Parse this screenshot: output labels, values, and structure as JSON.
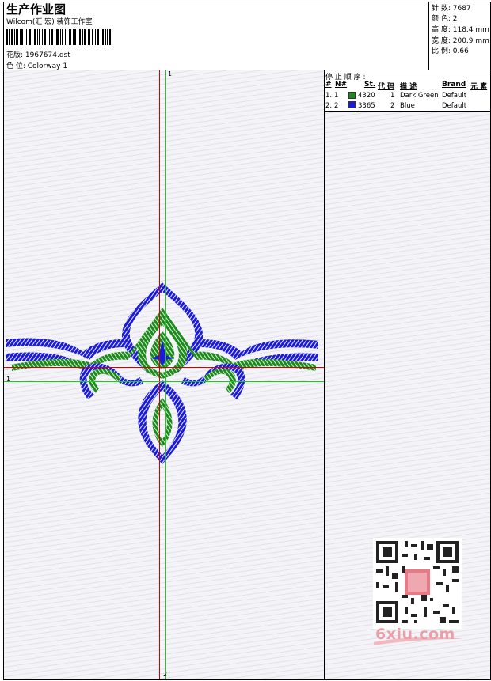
{
  "header": {
    "title": "生产作业图",
    "company": "Wilcom(汇 宏) 装饰工作室",
    "design": "花版: 1967674.dst",
    "colorway": "色 位:  Colorway 1"
  },
  "stats": {
    "stitches": "针 数:  7687",
    "colors": "颜 色:  2",
    "height": "高 度:  118.4 mm",
    "width": "宽 度:  200.9 mm",
    "scale": "比 例:  0.66"
  },
  "stop_sequence": {
    "label": "停 止 顺 序 :",
    "headers": [
      "#",
      "N#",
      "St.",
      "代 码",
      "描 述",
      "Brand",
      "元 素"
    ],
    "rows": [
      {
        "index": "1.",
        "n": "1",
        "stitches": "4320",
        "code": "1",
        "desc": "Dark Green",
        "brand": "Default",
        "color": "#1e8a1e"
      },
      {
        "index": "2.",
        "n": "2",
        "stitches": "3365",
        "code": "2",
        "desc": "Blue",
        "brand": "Default",
        "color": "#1a1ad8"
      }
    ]
  },
  "axes": {
    "top_label": "1",
    "left_label": "1",
    "bottom_label": "2"
  },
  "colors": {
    "green": "#1e8a1e",
    "blue": "#1a1ad8",
    "axis_red": "#d40000",
    "axis_green": "#1ec81e"
  },
  "watermark": {
    "text": "6xiu.com"
  }
}
